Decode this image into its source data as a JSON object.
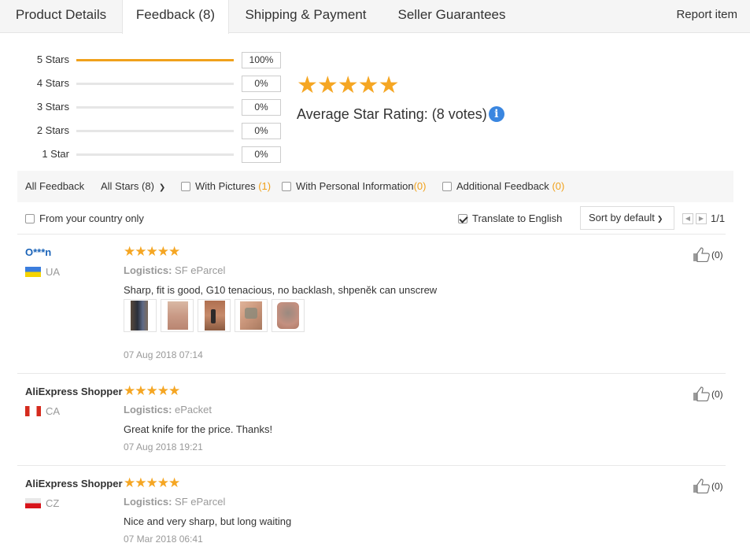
{
  "tabs": [
    {
      "label": "Product Details"
    },
    {
      "label": "Feedback (8)"
    },
    {
      "label": "Shipping & Payment"
    },
    {
      "label": "Seller Guarantees"
    }
  ],
  "report_label": "Report item",
  "histogram": [
    {
      "label": "5 Stars",
      "percent": "100%",
      "fill": 1.0
    },
    {
      "label": "4 Stars",
      "percent": "0%",
      "fill": 0
    },
    {
      "label": "3 Stars",
      "percent": "0%",
      "fill": 0
    },
    {
      "label": "2 Stars",
      "percent": "0%",
      "fill": 0
    },
    {
      "label": "1 Star",
      "percent": "0%",
      "fill": 0
    }
  ],
  "summary": {
    "stars": "★★★★★",
    "average_label": "Average Star Rating:",
    "votes": "(8 votes)",
    "info_glyph": "i"
  },
  "filters": {
    "all_feedback": "All Feedback",
    "all_stars": "All Stars (8)",
    "with_pictures": "With Pictures",
    "with_pictures_count": "(1)",
    "with_personal": "With Personal Information",
    "with_personal_count": "(0)",
    "additional": "Additional Feedback",
    "additional_count": "(0)"
  },
  "options": {
    "from_country": "From your country only",
    "translate": "Translate to English",
    "sort": "Sort by default",
    "page": "1/1"
  },
  "reviews": [
    {
      "name": "O***n",
      "country": "UA",
      "stars": "★★★★★",
      "logistics_label": "Logistics:",
      "logistics": "SF eParcel",
      "text": "Sharp, fit is good, G10 tenacious, no backlash, shpeněk can unscrew",
      "date": "07 Aug 2018 07:14",
      "likes": "(0)"
    },
    {
      "name": "AliExpress Shopper",
      "country": "CA",
      "stars": "★★★★★",
      "logistics_label": "Logistics:",
      "logistics": "ePacket",
      "text": "Great knife for the price. Thanks!",
      "date": "07 Aug 2018 19:21",
      "likes": "(0)"
    },
    {
      "name": "AliExpress Shopper",
      "country": "CZ",
      "stars": "★★★★★",
      "logistics_label": "Logistics:",
      "logistics": "SF eParcel",
      "text": "Nice and very sharp, but long waiting",
      "date": "07 Mar 2018 06:41",
      "likes": "(0)"
    }
  ],
  "colors": {
    "accent_orange": "#f0a11b",
    "star": "#f5a623",
    "link_blue": "#1a63b8",
    "info_blue": "#3a86e0"
  }
}
